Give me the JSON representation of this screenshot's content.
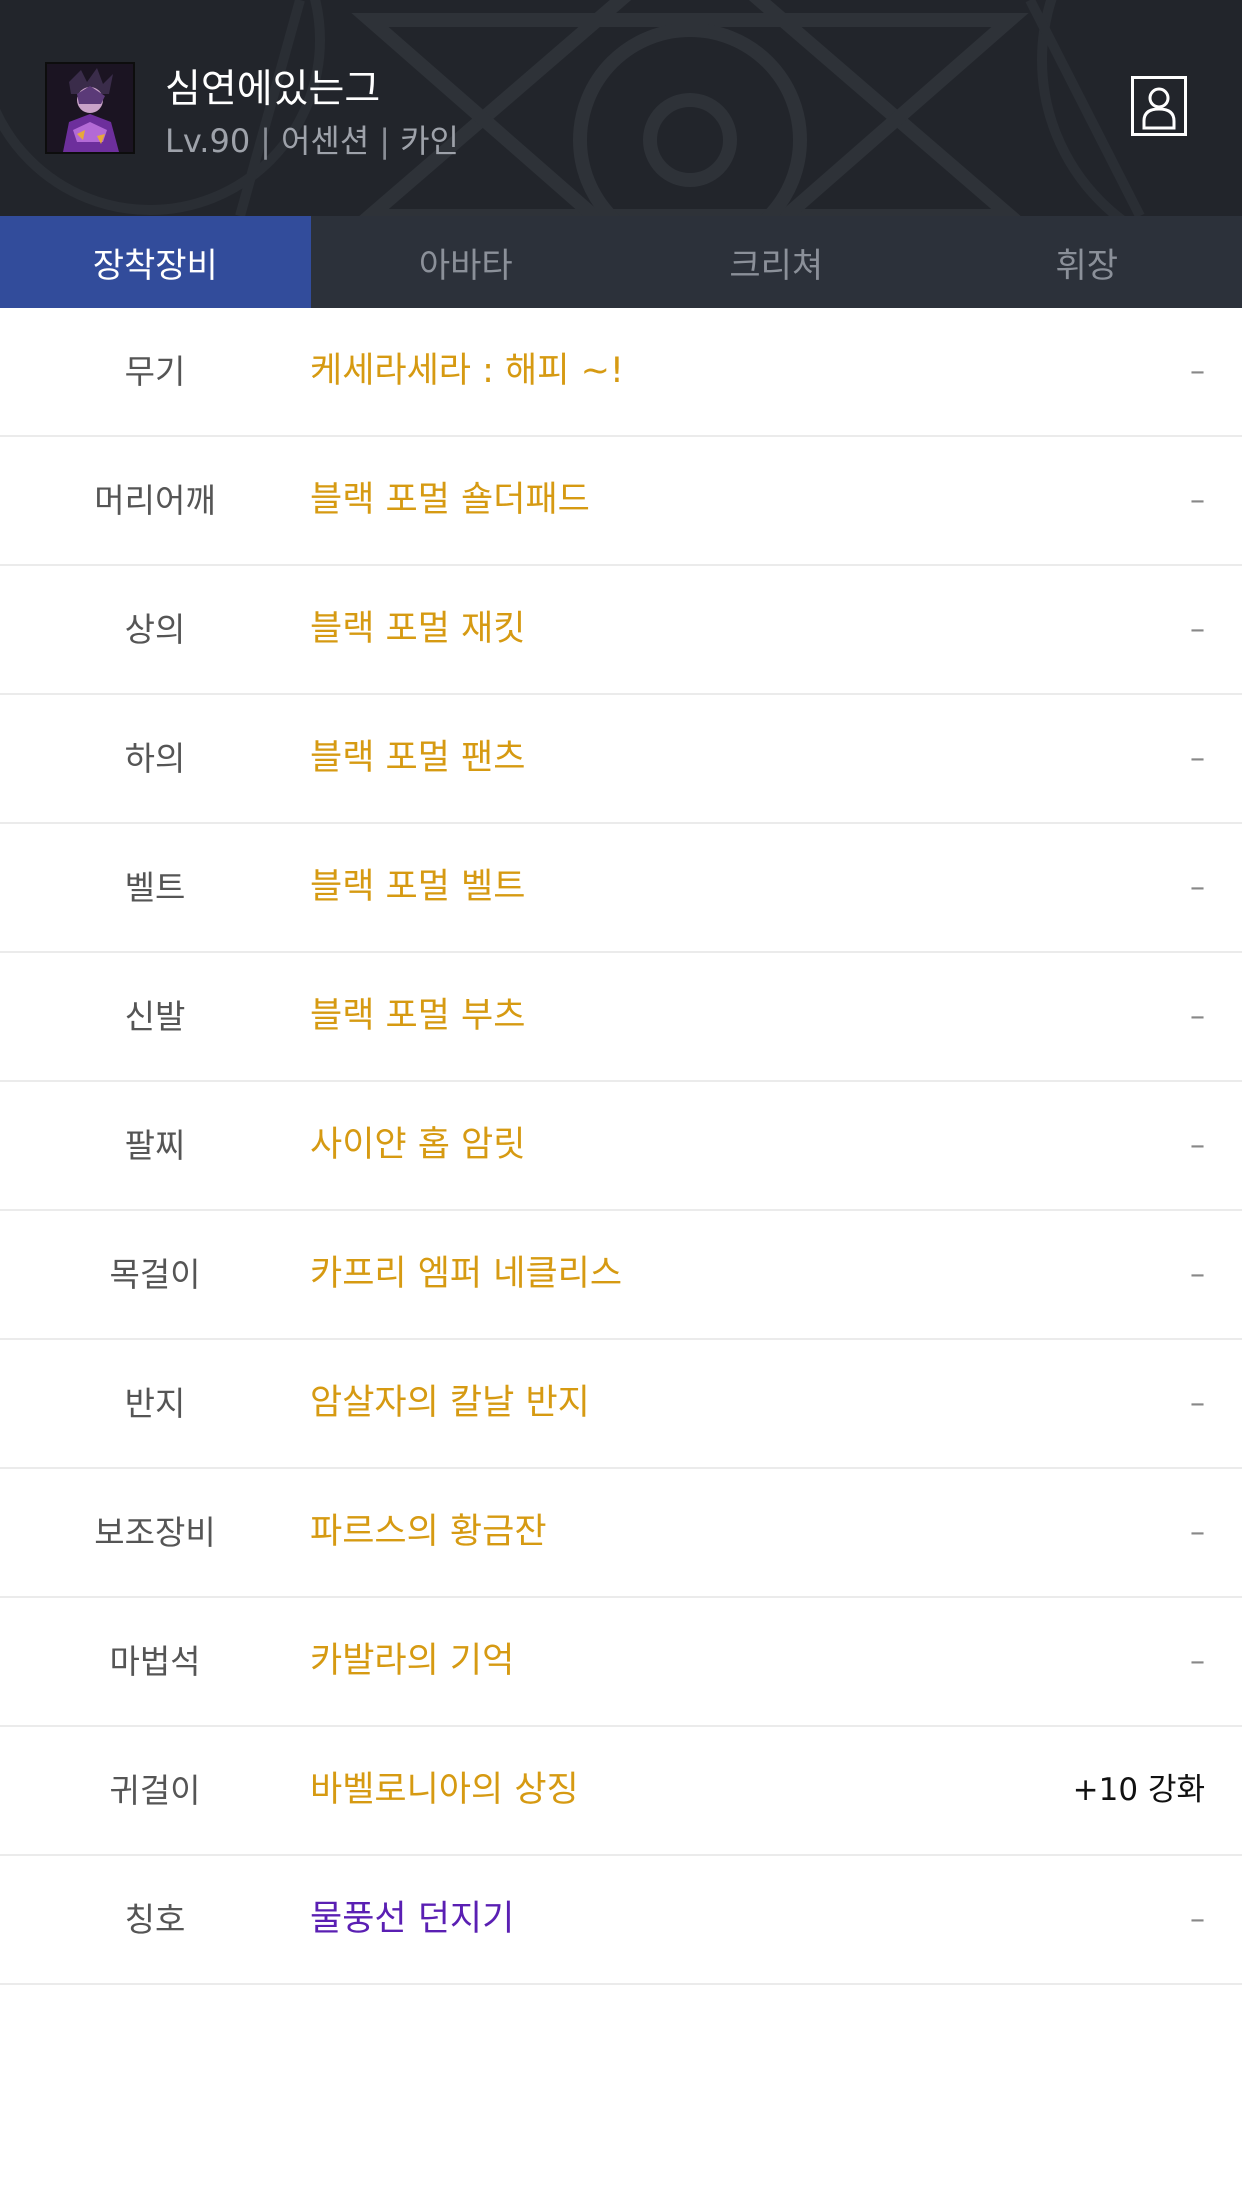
{
  "header": {
    "character_name": "심연에있는그",
    "level": "Lv.90",
    "job": "어센션",
    "server": "카인",
    "separator": "|"
  },
  "tabs": [
    {
      "label": "장착장비",
      "active": true
    },
    {
      "label": "아바타",
      "active": false
    },
    {
      "label": "크리쳐",
      "active": false
    },
    {
      "label": "휘장",
      "active": false
    }
  ],
  "equipment": [
    {
      "slot": "무기",
      "name": "케세라세라 : 해피 ~!",
      "enchant": "–",
      "rarity": "unique"
    },
    {
      "slot": "머리어깨",
      "name": "블랙 포멀 숄더패드",
      "enchant": "–",
      "rarity": "unique"
    },
    {
      "slot": "상의",
      "name": "블랙 포멀 재킷",
      "enchant": "–",
      "rarity": "unique"
    },
    {
      "slot": "하의",
      "name": "블랙 포멀 팬츠",
      "enchant": "–",
      "rarity": "unique"
    },
    {
      "slot": "벨트",
      "name": "블랙 포멀 벨트",
      "enchant": "–",
      "rarity": "unique"
    },
    {
      "slot": "신발",
      "name": "블랙 포멀 부츠",
      "enchant": "–",
      "rarity": "unique"
    },
    {
      "slot": "팔찌",
      "name": "사이얀 홉 암릿",
      "enchant": "–",
      "rarity": "unique"
    },
    {
      "slot": "목걸이",
      "name": "카프리 엠퍼 네클리스",
      "enchant": "–",
      "rarity": "unique"
    },
    {
      "slot": "반지",
      "name": "암살자의 칼날 반지",
      "enchant": "–",
      "rarity": "unique"
    },
    {
      "slot": "보조장비",
      "name": "파르스의 황금잔",
      "enchant": "–",
      "rarity": "unique"
    },
    {
      "slot": "마법석",
      "name": "카발라의 기억",
      "enchant": "–",
      "rarity": "unique"
    },
    {
      "slot": "귀걸이",
      "name": "바벨로니아의 상징",
      "enchant": "+10 강화",
      "rarity": "unique"
    },
    {
      "slot": "칭호",
      "name": "물풍선 던지기",
      "enchant": "–",
      "rarity": "rare"
    }
  ],
  "colors": {
    "header_bg": "#22252b",
    "tab_bar_bg": "#2c313a",
    "tab_active_bg": "#324c9b",
    "unique_item": "#d69a12",
    "rare_item": "#5a1fb3"
  },
  "icons": {
    "avatar": "character-portrait",
    "profile_button": "person-icon"
  }
}
